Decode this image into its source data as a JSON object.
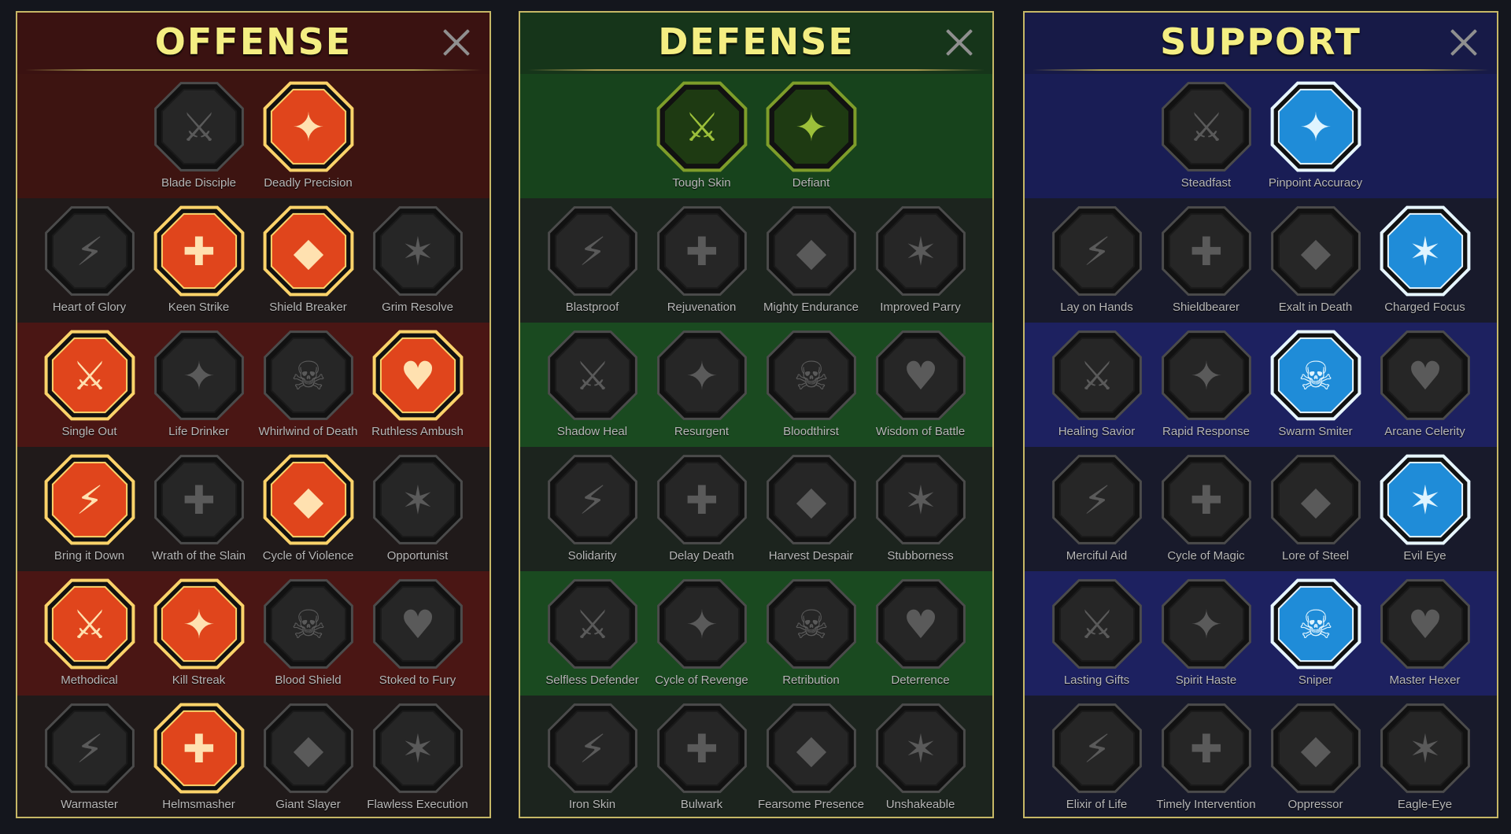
{
  "panels": [
    {
      "id": "offense",
      "title": "OFFENSE",
      "close_icon": "close-icon",
      "rows": [
        [
          {
            "name": "Blade Disciple",
            "icon": "crossed-swords-icon",
            "active": false
          },
          {
            "name": "Deadly Precision",
            "icon": "dagger-strike-icon",
            "active": true
          }
        ],
        [
          {
            "name": "Heart of Glory",
            "icon": "horned-figure-icon",
            "active": false
          },
          {
            "name": "Keen Strike",
            "icon": "spear-strike-icon",
            "active": true
          },
          {
            "name": "Shield Breaker",
            "icon": "broken-shield-icon",
            "active": true
          },
          {
            "name": "Grim Resolve",
            "icon": "spiked-heart-icon",
            "active": false
          }
        ],
        [
          {
            "name": "Single Out",
            "icon": "arrows-in-target-icon",
            "active": true
          },
          {
            "name": "Life Drinker",
            "icon": "fangs-icon",
            "active": false
          },
          {
            "name": "Whirlwind of Death",
            "icon": "skull-wind-icon",
            "active": false
          },
          {
            "name": "Ruthless Ambush",
            "icon": "knife-hand-icon",
            "active": true
          }
        ],
        [
          {
            "name": "Bring it Down",
            "icon": "sword-heart-icon",
            "active": true
          },
          {
            "name": "Wrath of the Slain",
            "icon": "fist-icon",
            "active": false
          },
          {
            "name": "Cycle of Violence",
            "icon": "axe-icon",
            "active": true
          },
          {
            "name": "Opportunist",
            "icon": "chain-bolt-icon",
            "active": false
          }
        ],
        [
          {
            "name": "Methodical",
            "icon": "arrows-shield-icon",
            "active": true
          },
          {
            "name": "Kill Streak",
            "icon": "skulls-icon",
            "active": true
          },
          {
            "name": "Blood Shield",
            "icon": "sword-shield-icon",
            "active": false
          },
          {
            "name": "Stoked to Fury",
            "icon": "raging-figure-icon",
            "active": false
          }
        ],
        [
          {
            "name": "Warmaster",
            "icon": "sword-sparkle-icon",
            "active": false
          },
          {
            "name": "Helmsmasher",
            "icon": "smashed-helm-icon",
            "active": true
          },
          {
            "name": "Giant Slayer",
            "icon": "giant-icon",
            "active": false
          },
          {
            "name": "Flawless Execution",
            "icon": "skull-helm-icon",
            "active": false
          }
        ]
      ]
    },
    {
      "id": "defense",
      "title": "DEFENSE",
      "close_icon": "close-icon",
      "rows": [
        [
          {
            "name": "Tough Skin",
            "icon": "scales-icon",
            "active": true
          },
          {
            "name": "Defiant",
            "icon": "raised-fist-icon",
            "active": true
          }
        ],
        [
          {
            "name": "Blastproof",
            "icon": "shield-icon",
            "active": false
          },
          {
            "name": "Rejuvenation",
            "icon": "heart-organ-icon",
            "active": false
          },
          {
            "name": "Mighty Endurance",
            "icon": "armored-figure-icon",
            "active": false
          },
          {
            "name": "Improved Parry",
            "icon": "parry-blades-icon",
            "active": false
          }
        ],
        [
          {
            "name": "Shadow Heal",
            "icon": "shadow-figure-icon",
            "active": false
          },
          {
            "name": "Resurgent",
            "icon": "knight-shield-icon",
            "active": false
          },
          {
            "name": "Bloodthirst",
            "icon": "skull-heart-icon",
            "active": false
          },
          {
            "name": "Wisdom of Battle",
            "icon": "monk-head-icon",
            "active": false
          }
        ],
        [
          {
            "name": "Solidarity",
            "icon": "crowd-icon",
            "active": false
          },
          {
            "name": "Delay Death",
            "icon": "hourglass-icon",
            "active": false
          },
          {
            "name": "Harvest Despair",
            "icon": "open-hand-icon",
            "active": false
          },
          {
            "name": "Stubborness",
            "icon": "bull-icon",
            "active": false
          }
        ],
        [
          {
            "name": "Selfless Defender",
            "icon": "running-figure-icon",
            "active": false
          },
          {
            "name": "Cycle of Revenge",
            "icon": "drops-icon",
            "active": false
          },
          {
            "name": "Retribution",
            "icon": "skull-sun-icon",
            "active": false
          },
          {
            "name": "Deterrence",
            "icon": "hand-swirl-icon",
            "active": false
          }
        ],
        [
          {
            "name": "Iron Skin",
            "icon": "spiky-figure-icon",
            "active": false
          },
          {
            "name": "Bulwark",
            "icon": "winged-shield-icon",
            "active": false
          },
          {
            "name": "Fearsome Presence",
            "icon": "skull-cloak-icon",
            "active": false
          },
          {
            "name": "Unshakeable",
            "icon": "strong-figure-icon",
            "active": false
          }
        ]
      ]
    },
    {
      "id": "support",
      "title": "SUPPORT",
      "close_icon": "close-icon",
      "rows": [
        [
          {
            "name": "Steadfast",
            "icon": "heart-plus-icon",
            "active": false
          },
          {
            "name": "Pinpoint Accuracy",
            "icon": "target-burst-icon",
            "active": true
          }
        ],
        [
          {
            "name": "Lay on Hands",
            "icon": "praying-hands-icon",
            "active": false
          },
          {
            "name": "Shieldbearer",
            "icon": "shield-rings-icon",
            "active": false
          },
          {
            "name": "Exalt in Death",
            "icon": "flaming-skull-icon",
            "active": false
          },
          {
            "name": "Charged Focus",
            "icon": "rushing-hand-icon",
            "active": true
          }
        ],
        [
          {
            "name": "Healing Savior",
            "icon": "healing-figure-icon",
            "active": false
          },
          {
            "name": "Rapid Response",
            "icon": "lightning-icon",
            "active": false
          },
          {
            "name": "Swarm Smiter",
            "icon": "zigzag-bolts-icon",
            "active": true
          },
          {
            "name": "Arcane Celerity",
            "icon": "figure-trail-icon",
            "active": false
          }
        ],
        [
          {
            "name": "Merciful Aid",
            "icon": "chained-heart-icon",
            "active": false
          },
          {
            "name": "Cycle of Magic",
            "icon": "comet-icon",
            "active": false
          },
          {
            "name": "Lore of Steel",
            "icon": "open-book-icon",
            "active": false
          },
          {
            "name": "Evil Eye",
            "icon": "evil-eyes-icon",
            "active": true
          }
        ],
        [
          {
            "name": "Lasting Gifts",
            "icon": "star-compass-icon",
            "active": false
          },
          {
            "name": "Spirit Haste",
            "icon": "speed-boot-icon",
            "active": false
          },
          {
            "name": "Sniper",
            "icon": "eye-icon",
            "active": true
          },
          {
            "name": "Master Hexer",
            "icon": "voodoo-doll-icon",
            "active": false
          }
        ],
        [
          {
            "name": "Elixir of Life",
            "icon": "potion-icon",
            "active": false
          },
          {
            "name": "Timely Intervention",
            "icon": "skull-claw-icon",
            "active": false
          },
          {
            "name": "Oppressor",
            "icon": "grasping-hand-icon",
            "active": false
          },
          {
            "name": "Eagle-Eye",
            "icon": "eagle-icon",
            "active": false
          }
        ]
      ]
    }
  ],
  "colors": {
    "offense_active_outer": "#fbd36a",
    "offense_active_inner": "#e0451c",
    "defense_active_outer": "#7e9d2a",
    "defense_active_inner": "#1e3a12",
    "support_active_outer": "#e7f6ff",
    "support_active_inner": "#1f8cd8",
    "inactive_outer": "#4b4b4b",
    "inactive_inner": "#262626",
    "title_color": "#f4ee82"
  }
}
